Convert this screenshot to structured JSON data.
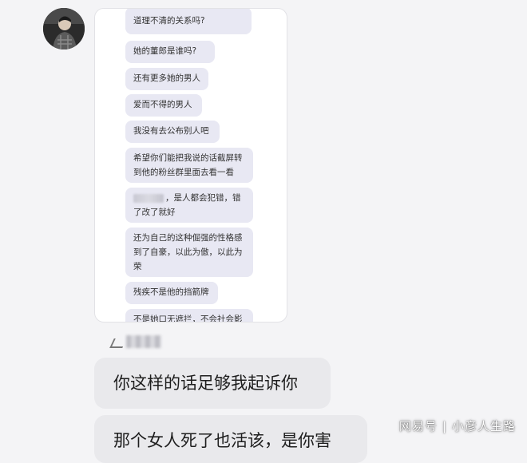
{
  "colors": {
    "background": "#f4f4f6",
    "bubble": "#e9e9ec",
    "inner_bubble": "#e8e8f3"
  },
  "avatar_icon": "person-avatar",
  "embedded_screenshot": {
    "messages": [
      "道理不清的关系吗?",
      "她的董郎是谁吗?",
      "还有更多她的男人",
      "爱而不得的男人",
      "我没有去公布别人吧",
      "希望你们能把我说的话截屏转\n到他的粉丝群里面去看一看",
      "，是人都会犯错，错\n了改了就好",
      "还为自己的这种倔强的性格感\n到了自豪，以此为傲，以此为\n荣",
      "残疾不是他的挡箭牌",
      "不是她口无遮拦，不会社会影"
    ]
  },
  "chat": {
    "messages": [
      "你这样的话足够我起诉你",
      "那个女人死了也活该，是你害"
    ]
  },
  "watermark": {
    "source": "网易号",
    "separator": "|",
    "author": "小彦人生路"
  }
}
